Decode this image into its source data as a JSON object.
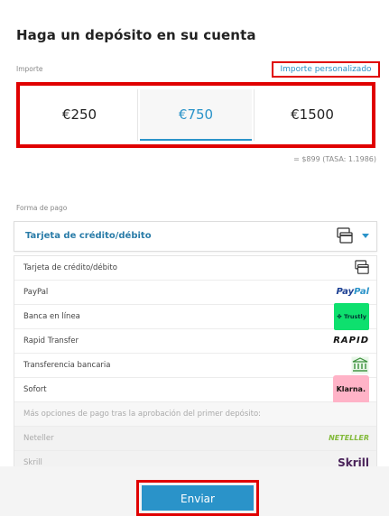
{
  "page": {
    "title": "Haga un depósito en su cuenta"
  },
  "amount": {
    "label": "Importe",
    "custom_link": "Importe personalizado",
    "options": [
      "€250",
      "€750",
      "€1500"
    ],
    "selected": "€750",
    "conversion": "= $899   (TASA: 1.1986)"
  },
  "payment": {
    "label": "Forma de pago",
    "selected": "Tarjeta de crédito/débito",
    "methods": [
      {
        "label": "Tarjeta de crédito/débito",
        "icon": "credit-card-icon"
      },
      {
        "label": "PayPal",
        "icon": "paypal-logo"
      },
      {
        "label": "Banca en línea",
        "icon": "trustly-logo"
      },
      {
        "label": "Rapid Transfer",
        "icon": "rapid-transfer-logo"
      },
      {
        "label": "Transferencia bancaria",
        "icon": "bank-icon"
      },
      {
        "label": "Sofort",
        "icon": "klarna-logo"
      }
    ],
    "info_text": "Más opciones de pago tras la aprobación del primer depósito:",
    "disabled_methods": [
      {
        "label": "Neteller",
        "icon": "neteller-logo"
      },
      {
        "label": "Skrill",
        "icon": "skrill-logo"
      }
    ],
    "logos": {
      "paypal_a": "Pay",
      "paypal_b": "Pal",
      "trustly": "✤ Trustly",
      "rapid": "RAPID",
      "klarna": "Klarna.",
      "neteller": "NETELLER",
      "skrill": "Skrill"
    }
  },
  "footer": {
    "submit_label": "Enviar"
  },
  "colors": {
    "accent": "#2a93c9",
    "highlight": "#e00000",
    "select_text": "#2a7ca8"
  }
}
